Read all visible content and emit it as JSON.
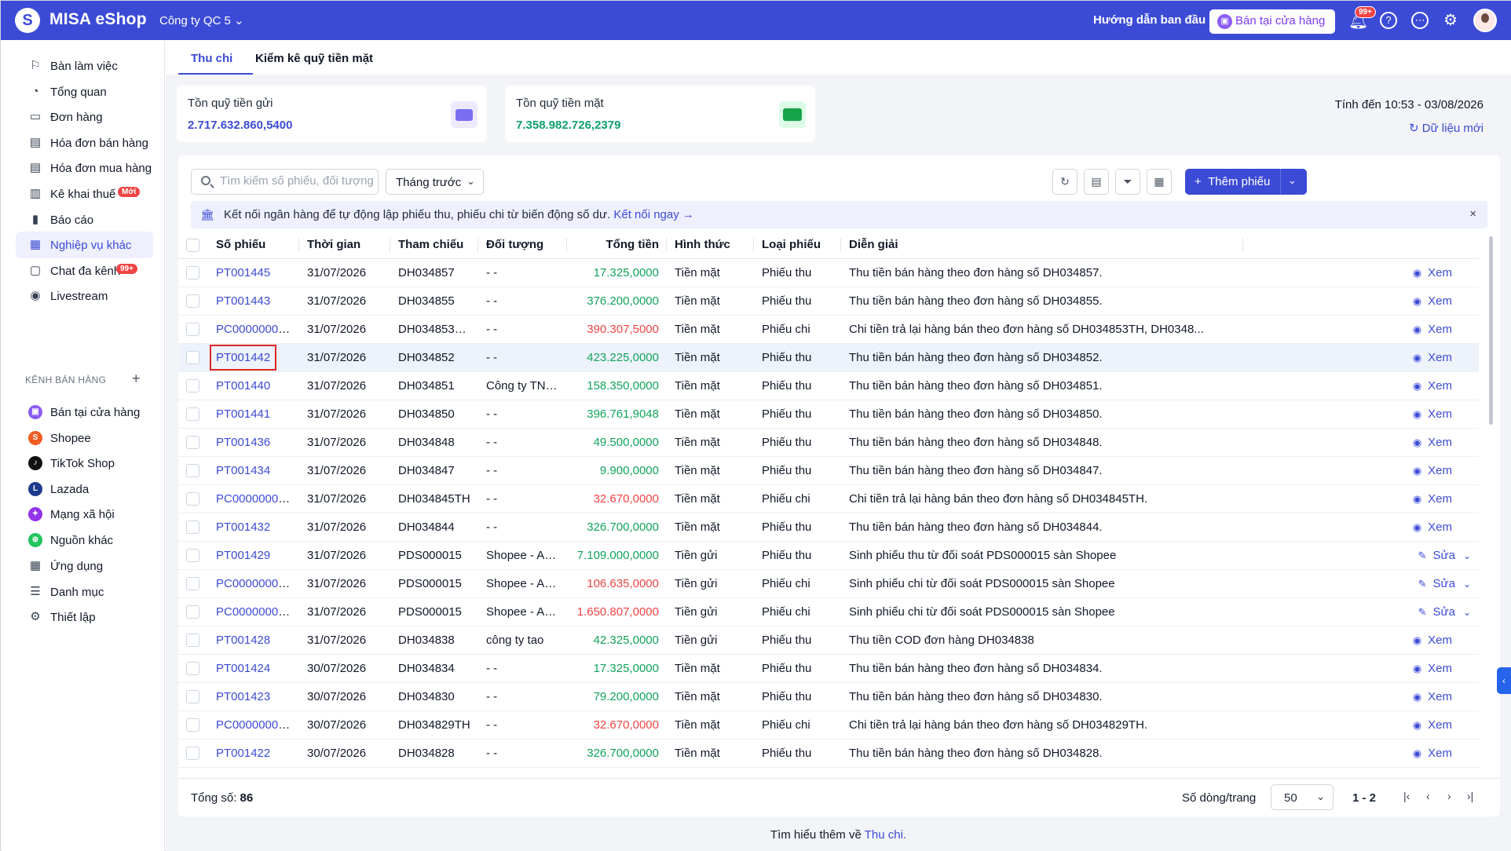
{
  "topbar": {
    "brand": "MISA eShop",
    "company": "Công ty QC 5",
    "guide": "Hướng dẫn ban đầu",
    "store_button": "Bán tại cửa hàng",
    "notif_badge": "99+",
    "accent": "#3c4bd6"
  },
  "sidebar": {
    "items": [
      {
        "label": "Bàn làm việc",
        "icon": "flag-icon"
      },
      {
        "label": "Tổng quan",
        "icon": "gauge-icon"
      },
      {
        "label": "Đơn hàng",
        "icon": "order-icon"
      },
      {
        "label": "Hóa đơn bán hàng",
        "icon": "invoice-icon"
      },
      {
        "label": "Hóa đơn mua hàng",
        "icon": "invoice-icon"
      },
      {
        "label": "Kê khai thuế",
        "icon": "tax-icon",
        "badge": "Mới"
      },
      {
        "label": "Báo cáo",
        "icon": "report-icon"
      },
      {
        "label": "Nghiệp vụ khác",
        "icon": "grid-icon"
      },
      {
        "label": "Chat đa kênh",
        "icon": "chat-icon",
        "badge": "99+"
      },
      {
        "label": "Livestream",
        "icon": "live-icon"
      }
    ],
    "channels_heading": "KÊNH BÁN HÀNG",
    "channels": [
      {
        "label": "Bán tại cửa hàng",
        "icon": "store-icon",
        "color": "#8b5cf6"
      },
      {
        "label": "Shopee",
        "icon": "shopee-icon",
        "color": "#f05d23"
      },
      {
        "label": "TikTok Shop",
        "icon": "tiktok-icon",
        "color": "#111111"
      },
      {
        "label": "Lazada",
        "icon": "lazada-icon",
        "color": "#1e3a8a"
      },
      {
        "label": "Mạng xã hội",
        "icon": "social-icon",
        "color": "#9333ea"
      },
      {
        "label": "Nguồn khác",
        "icon": "cart-icon",
        "color": "#22c55e"
      }
    ],
    "bottom_items": [
      {
        "label": "Ứng dụng",
        "icon": "apps-icon"
      },
      {
        "label": "Danh mục",
        "icon": "list-icon"
      },
      {
        "label": "Thiết lập",
        "icon": "gear-icon"
      }
    ]
  },
  "tabs": [
    "Thu chi",
    "Kiểm kê quỹ tiền mặt"
  ],
  "cards": [
    {
      "title": "Tồn quỹ tiền gửi",
      "value": "2.717.632.860,5400",
      "color": "#3c4bd6"
    },
    {
      "title": "Tồn quỹ tiền mặt",
      "value": "7.358.982.726,2379",
      "color": "#0e9f6e"
    }
  ],
  "as_of": "Tính đến 10:53 - 03/08/2026",
  "refresh_label": "Dữ liệu mới",
  "toolbar": {
    "search_placeholder": "Tìm kiếm số phiếu, đối tượng",
    "period": "Tháng trước",
    "add_label": "Thêm phiếu"
  },
  "banner": {
    "text": "Kết nối ngân hàng để tự động lập phiếu thu, phiếu chi từ biến động số dư.",
    "link": "Kết nối ngay →"
  },
  "table": {
    "columns": [
      "Số phiếu",
      "Thời gian",
      "Tham chiếu",
      "Đối tượng",
      "Tổng tiền",
      "Hình thức",
      "Loại phiếu",
      "Diễn giải"
    ],
    "rows": [
      {
        "no": "PT001445",
        "date": "31/07/2026",
        "ref": "DH034857",
        "obj": "- -",
        "amount": "17.325,0000",
        "sign": "pos",
        "method": "Tiền mặt",
        "type": "Phiếu thu",
        "desc": "Thu tiền bán hàng theo đơn hàng số DH034857.",
        "action": "Xem"
      },
      {
        "no": "PT001443",
        "date": "31/07/2026",
        "ref": "DH034855",
        "obj": "- -",
        "amount": "376.200,0000",
        "sign": "pos",
        "method": "Tiền mặt",
        "type": "Phiếu thu",
        "desc": "Thu tiền bán hàng theo đơn hàng số DH034855.",
        "action": "Xem"
      },
      {
        "no": "PC000000000...",
        "date": "31/07/2026",
        "ref": "DH034853TH,...",
        "obj": "- -",
        "amount": "390.307,5000",
        "sign": "neg",
        "method": "Tiền mặt",
        "type": "Phiếu chi",
        "desc": "Chi tiền trả lại hàng bán theo đơn hàng số DH034853TH, DH0348...",
        "action": "Xem"
      },
      {
        "no": "PT001442",
        "date": "31/07/2026",
        "ref": "DH034852",
        "obj": "- -",
        "amount": "423.225,0000",
        "sign": "pos",
        "method": "Tiền mặt",
        "type": "Phiếu thu",
        "desc": "Thu tiền bán hàng theo đơn hàng số DH034852.",
        "action": "Xem",
        "highlight": true
      },
      {
        "no": "PT001440",
        "date": "31/07/2026",
        "ref": "DH034851",
        "obj": "Công ty TNHH ...",
        "amount": "158.350,0000",
        "sign": "pos",
        "method": "Tiền mặt",
        "type": "Phiếu thu",
        "desc": "Thu tiền bán hàng theo đơn hàng số DH034851.",
        "action": "Xem"
      },
      {
        "no": "PT001441",
        "date": "31/07/2026",
        "ref": "DH034850",
        "obj": "- -",
        "amount": "396.761,9048",
        "sign": "pos",
        "method": "Tiền mặt",
        "type": "Phiếu thu",
        "desc": "Thu tiền bán hàng theo đơn hàng số DH034850.",
        "action": "Xem"
      },
      {
        "no": "PT001436",
        "date": "31/07/2026",
        "ref": "DH034848",
        "obj": "- -",
        "amount": "49.500,0000",
        "sign": "pos",
        "method": "Tiền mặt",
        "type": "Phiếu thu",
        "desc": "Thu tiền bán hàng theo đơn hàng số DH034848.",
        "action": "Xem"
      },
      {
        "no": "PT001434",
        "date": "31/07/2026",
        "ref": "DH034847",
        "obj": "- -",
        "amount": "9.900,0000",
        "sign": "pos",
        "method": "Tiền mặt",
        "type": "Phiếu thu",
        "desc": "Thu tiền bán hàng theo đơn hàng số DH034847.",
        "action": "Xem"
      },
      {
        "no": "PC000000000...",
        "date": "31/07/2026",
        "ref": "DH034845TH",
        "obj": "- -",
        "amount": "32.670,0000",
        "sign": "neg",
        "method": "Tiền mặt",
        "type": "Phiếu chi",
        "desc": "Chi tiền trả lại hàng bán theo đơn hàng số DH034845TH.",
        "action": "Xem"
      },
      {
        "no": "PT001432",
        "date": "31/07/2026",
        "ref": "DH034844",
        "obj": "- -",
        "amount": "326.700,0000",
        "sign": "pos",
        "method": "Tiền mặt",
        "type": "Phiếu thu",
        "desc": "Thu tiền bán hàng theo đơn hàng số DH034844.",
        "action": "Xem"
      },
      {
        "no": "PT001429",
        "date": "31/07/2026",
        "ref": "PDS000015",
        "obj": "Shopee - Auth...",
        "amount": "7.109.000,0000",
        "sign": "pos",
        "method": "Tiền gửi",
        "type": "Phiếu thu",
        "desc": "Sinh phiếu thu từ đối soát PDS000015 sàn Shopee",
        "action": "Sửa"
      },
      {
        "no": "PC000000000...",
        "date": "31/07/2026",
        "ref": "PDS000015",
        "obj": "Shopee - Auth...",
        "amount": "106.635,0000",
        "sign": "neg",
        "method": "Tiền gửi",
        "type": "Phiếu chi",
        "desc": "Sinh phiếu chi từ đối soát PDS000015 sàn Shopee",
        "action": "Sửa"
      },
      {
        "no": "PC000000000...",
        "date": "31/07/2026",
        "ref": "PDS000015",
        "obj": "Shopee - Auth...",
        "amount": "1.650.807,0000",
        "sign": "neg",
        "method": "Tiền gửi",
        "type": "Phiếu chi",
        "desc": "Sinh phiếu chi từ đối soát PDS000015 sàn Shopee",
        "action": "Sửa"
      },
      {
        "no": "PT001428",
        "date": "31/07/2026",
        "ref": "DH034838",
        "obj": "công ty tao",
        "amount": "42.325,0000",
        "sign": "pos",
        "method": "Tiền gửi",
        "type": "Phiếu thu",
        "desc": "Thu tiền COD đơn hàng DH034838",
        "action": "Xem"
      },
      {
        "no": "PT001424",
        "date": "30/07/2026",
        "ref": "DH034834",
        "obj": "- -",
        "amount": "17.325,0000",
        "sign": "pos",
        "method": "Tiền mặt",
        "type": "Phiếu thu",
        "desc": "Thu tiền bán hàng theo đơn hàng số DH034834.",
        "action": "Xem"
      },
      {
        "no": "PT001423",
        "date": "30/07/2026",
        "ref": "DH034830",
        "obj": "- -",
        "amount": "79.200,0000",
        "sign": "pos",
        "method": "Tiền mặt",
        "type": "Phiếu thu",
        "desc": "Thu tiền bán hàng theo đơn hàng số DH034830.",
        "action": "Xem"
      },
      {
        "no": "PC000000000...",
        "date": "30/07/2026",
        "ref": "DH034829TH",
        "obj": "- -",
        "amount": "32.670,0000",
        "sign": "neg",
        "method": "Tiền mặt",
        "type": "Phiếu chi",
        "desc": "Chi tiền trả lại hàng bán theo đơn hàng số DH034829TH.",
        "action": "Xem"
      },
      {
        "no": "PT001422",
        "date": "30/07/2026",
        "ref": "DH034828",
        "obj": "- -",
        "amount": "326.700,0000",
        "sign": "pos",
        "method": "Tiền mặt",
        "type": "Phiếu thu",
        "desc": "Thu tiền bán hàng theo đơn hàng số DH034828.",
        "action": "Xem"
      }
    ]
  },
  "footer": {
    "total_label": "Tổng số:",
    "total": "86",
    "per_page_label": "Số dòng/trang",
    "page_size": "50",
    "range": "1 - 2"
  },
  "learn_more": {
    "text": "Tìm hiểu thêm về",
    "link": "Thu chi."
  }
}
